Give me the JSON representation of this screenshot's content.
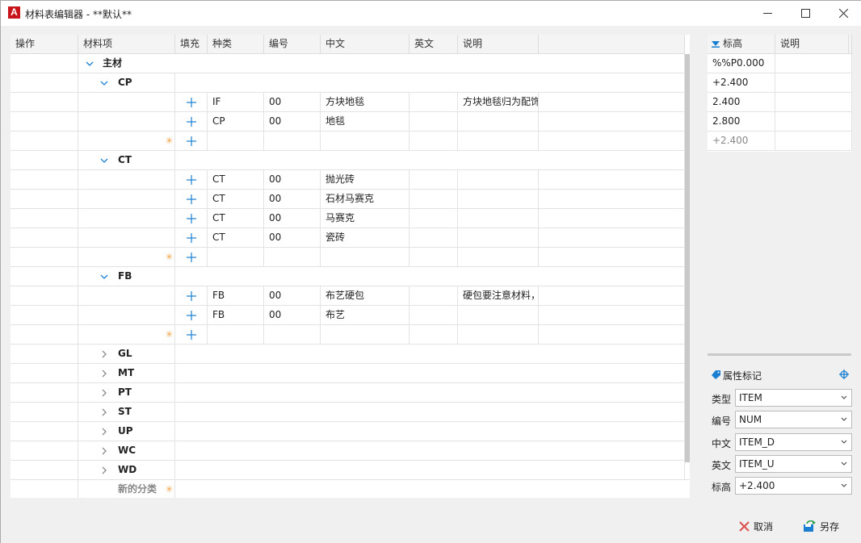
{
  "window": {
    "title": "材料表编辑器 - **默认**",
    "app_icon": "A"
  },
  "grid": {
    "headers": [
      "操作",
      "材料项",
      "填充",
      "种类",
      "编号",
      "中文",
      "英文",
      "说明"
    ],
    "root_label": "主材",
    "groups": [
      {
        "label": "CP",
        "expanded": true,
        "rows": [
          {
            "kind": "IF",
            "num": "00",
            "zh": "方块地毯",
            "en": "",
            "desc": "方块地毯归为配饰"
          },
          {
            "kind": "CP",
            "num": "00",
            "zh": "地毯",
            "en": "",
            "desc": ""
          }
        ]
      },
      {
        "label": "CT",
        "expanded": true,
        "rows": [
          {
            "kind": "CT",
            "num": "00",
            "zh": "抛光砖",
            "en": "",
            "desc": ""
          },
          {
            "kind": "CT",
            "num": "00",
            "zh": "石材马赛克",
            "en": "",
            "desc": ""
          },
          {
            "kind": "CT",
            "num": "00",
            "zh": "马赛克",
            "en": "",
            "desc": ""
          },
          {
            "kind": "CT",
            "num": "00",
            "zh": "瓷砖",
            "en": "",
            "desc": ""
          }
        ]
      },
      {
        "label": "FB",
        "expanded": true,
        "rows": [
          {
            "kind": "FB",
            "num": "00",
            "zh": "布艺硬包",
            "en": "",
            "desc": "硬包要注意材料，"
          },
          {
            "kind": "FB",
            "num": "00",
            "zh": "布艺",
            "en": "",
            "desc": ""
          }
        ]
      },
      {
        "label": "GL",
        "expanded": false,
        "rows": []
      },
      {
        "label": "MT",
        "expanded": false,
        "rows": []
      },
      {
        "label": "PT",
        "expanded": false,
        "rows": []
      },
      {
        "label": "ST",
        "expanded": false,
        "rows": []
      },
      {
        "label": "UP",
        "expanded": false,
        "rows": []
      },
      {
        "label": "WC",
        "expanded": false,
        "rows": []
      },
      {
        "label": "WD",
        "expanded": false,
        "rows": []
      }
    ],
    "new_category_label": "新的分类"
  },
  "elevation_panel": {
    "headers": [
      "标高",
      "说明"
    ],
    "rows": [
      {
        "value": "%%P0.000",
        "desc": "",
        "muted": false
      },
      {
        "value": "+2.400",
        "desc": "",
        "muted": false
      },
      {
        "value": "2.400",
        "desc": "",
        "muted": false
      },
      {
        "value": "2.800",
        "desc": "",
        "muted": false
      },
      {
        "value": "+2.400",
        "desc": "",
        "muted": true
      }
    ]
  },
  "properties": {
    "title": "属性标记",
    "fields": [
      {
        "label": "类型",
        "value": "ITEM"
      },
      {
        "label": "编号",
        "value": "NUM"
      },
      {
        "label": "中文",
        "value": "ITEM_D"
      },
      {
        "label": "英文",
        "value": "ITEM_U"
      },
      {
        "label": "标高",
        "value": "+2.400"
      }
    ]
  },
  "footer": {
    "cancel_label": "取消",
    "save_as_label": "另存"
  },
  "colors": {
    "accent": "#1a7fd0",
    "star": "#f0a040",
    "cancel_red": "#d9534f",
    "brand_red": "#c8151b"
  }
}
